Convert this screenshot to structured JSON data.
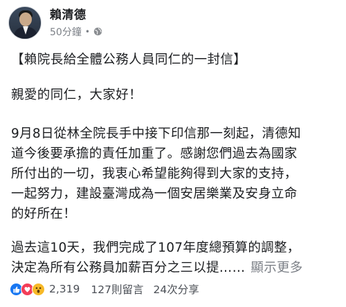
{
  "post": {
    "author": "賴清德",
    "time": "50分鐘",
    "separator": "•",
    "title": "【賴院長給全體公務人員同仁的一封信】",
    "greeting": "親愛的同仁，大家好！",
    "paragraph1_lines": [
      "9月8日從林全院長手中接下印信那一刻起，清德知",
      "道今後要承擔的責任加重了。感謝您們過去為國家",
      "所付出的一切，我衷心希望能夠得到大家的支持，",
      "一起努力，建設臺灣成為一個安居樂業及安身立命",
      "的好所在！"
    ],
    "paragraph2_lines": [
      "過去這10天，我們完成了107年度總預算的調整，",
      "決定為所有公務員加薪百分之三以提……"
    ],
    "see_more": "顯示更多"
  },
  "engagement": {
    "reaction_icons": [
      "like-icon",
      "love-icon",
      "wow-icon"
    ],
    "reaction_count": "2,319",
    "comments": "127則留言",
    "shares": "24次分享"
  },
  "colors": {
    "text": "#1c1e21",
    "muted": "#7c8087",
    "like": "#1877f2",
    "love": "#f33e58",
    "wow": "#f7b928"
  }
}
